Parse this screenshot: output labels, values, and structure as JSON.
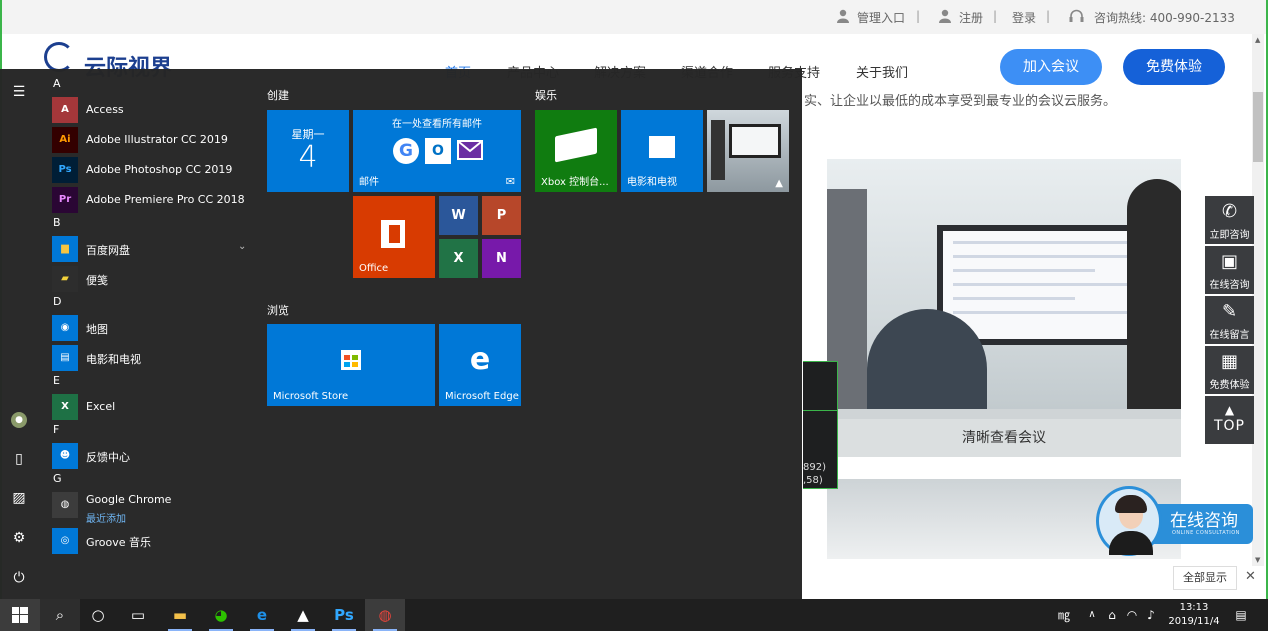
{
  "site": {
    "topbar": {
      "admin": "管理入口",
      "register": "注册",
      "login": "登录",
      "hotline": "咨询热线: 400-990-2133"
    },
    "logo_text": "云际视界",
    "nav": [
      "首页",
      "产品中心",
      "解决方案",
      "渠道合作",
      "服务支持",
      "关于我们"
    ],
    "join_button": "加入会议",
    "free_button": "免费体验",
    "subtext": "实、让企业以最低的成本享受到最专业的会议云服务。",
    "photo1_caption": "清晰查看会议",
    "side_float": [
      {
        "icon": "phone-icon",
        "label": "立即咨询"
      },
      {
        "icon": "chat-icon",
        "label": "在线咨询"
      },
      {
        "icon": "edit-icon",
        "label": "在线留言"
      },
      {
        "icon": "calendar-icon",
        "label": "免费体验"
      },
      {
        "icon": "arrow-up-icon",
        "label": "TOP"
      }
    ],
    "consult_big": "在线咨询",
    "consult_small": "ONLINE CONSULTATION",
    "show_all": "全部显示",
    "tooltip": {
      "line1": "892)",
      "line2": ",58)"
    }
  },
  "start_menu": {
    "groups": {
      "create": "创建",
      "play": "娱乐",
      "browse": "浏览"
    },
    "app_list": [
      {
        "type": "letter",
        "text": "A"
      },
      {
        "type": "app",
        "name": "Access",
        "icon": "access-icon",
        "glyph": "A",
        "color": "#a4373a"
      },
      {
        "type": "app",
        "name": "Adobe Illustrator CC 2019",
        "icon": "illustrator-icon",
        "glyph": "Ai",
        "color": "#330000",
        "fg": "#ff9a00"
      },
      {
        "type": "app",
        "name": "Adobe Photoshop CC 2019",
        "icon": "photoshop-icon",
        "glyph": "Ps",
        "color": "#001e36",
        "fg": "#31a8ff"
      },
      {
        "type": "app",
        "name": "Adobe Premiere Pro CC 2018",
        "icon": "premiere-icon",
        "glyph": "Pr",
        "color": "#2a0634",
        "fg": "#e88aff"
      },
      {
        "type": "letter",
        "text": "B"
      },
      {
        "type": "app",
        "name": "百度网盘",
        "icon": "folder-icon",
        "glyph": "▆",
        "color": "#0078d7",
        "fg": "#f5c542",
        "chevron": true
      },
      {
        "type": "app",
        "name": "便笺",
        "icon": "sticky-notes-icon",
        "glyph": "▰",
        "color": "#2d2d2d",
        "fg": "#f2d13a"
      },
      {
        "type": "letter",
        "text": "D"
      },
      {
        "type": "app",
        "name": "地图",
        "icon": "maps-icon",
        "glyph": "◉",
        "color": "#0078d7"
      },
      {
        "type": "app",
        "name": "电影和电视",
        "icon": "movies-icon",
        "glyph": "▤",
        "color": "#0078d7"
      },
      {
        "type": "letter",
        "text": "E"
      },
      {
        "type": "app",
        "name": "Excel",
        "icon": "excel-icon",
        "glyph": "X",
        "color": "#1e7145"
      },
      {
        "type": "letter",
        "text": "F"
      },
      {
        "type": "app",
        "name": "反馈中心",
        "icon": "feedback-icon",
        "glyph": "☻",
        "color": "#0078d7"
      },
      {
        "type": "letter",
        "text": "G"
      },
      {
        "type": "app",
        "name": "Google Chrome",
        "sub": "最近添加",
        "icon": "chrome-icon",
        "glyph": "◍",
        "color": "#3c3c3c"
      },
      {
        "type": "app",
        "name": "Groove 音乐",
        "icon": "groove-icon",
        "glyph": "◎",
        "color": "#0078d7"
      }
    ],
    "tiles": {
      "calendar_day": "星期一",
      "calendar_date": "4",
      "mail_heading": "在一处查看所有邮件",
      "mail_label": "邮件",
      "office_label": "Office",
      "xbox_label": "Xbox 控制台...",
      "movies_label": "电影和电视",
      "store_label": "Microsoft Store",
      "edge_label": "Microsoft Edge"
    }
  },
  "taskbar": {
    "clock_time": "13:13",
    "clock_date": "2019/11/4",
    "apps": [
      {
        "name": "file-explorer-icon",
        "glyph": "▬",
        "color": "#f3c04a"
      },
      {
        "name": "wechat-icon",
        "glyph": "◕",
        "color": "#2dc100"
      },
      {
        "name": "edge-icon",
        "glyph": "e",
        "color": "#1e90e8"
      },
      {
        "name": "photos-icon",
        "glyph": "▲",
        "color": "#ffffff"
      },
      {
        "name": "photoshop-taskbar-icon",
        "glyph": "Ps",
        "color": "#31a8ff"
      },
      {
        "name": "chrome-taskbar-icon",
        "glyph": "◍",
        "color": "#e8453c"
      }
    ]
  }
}
